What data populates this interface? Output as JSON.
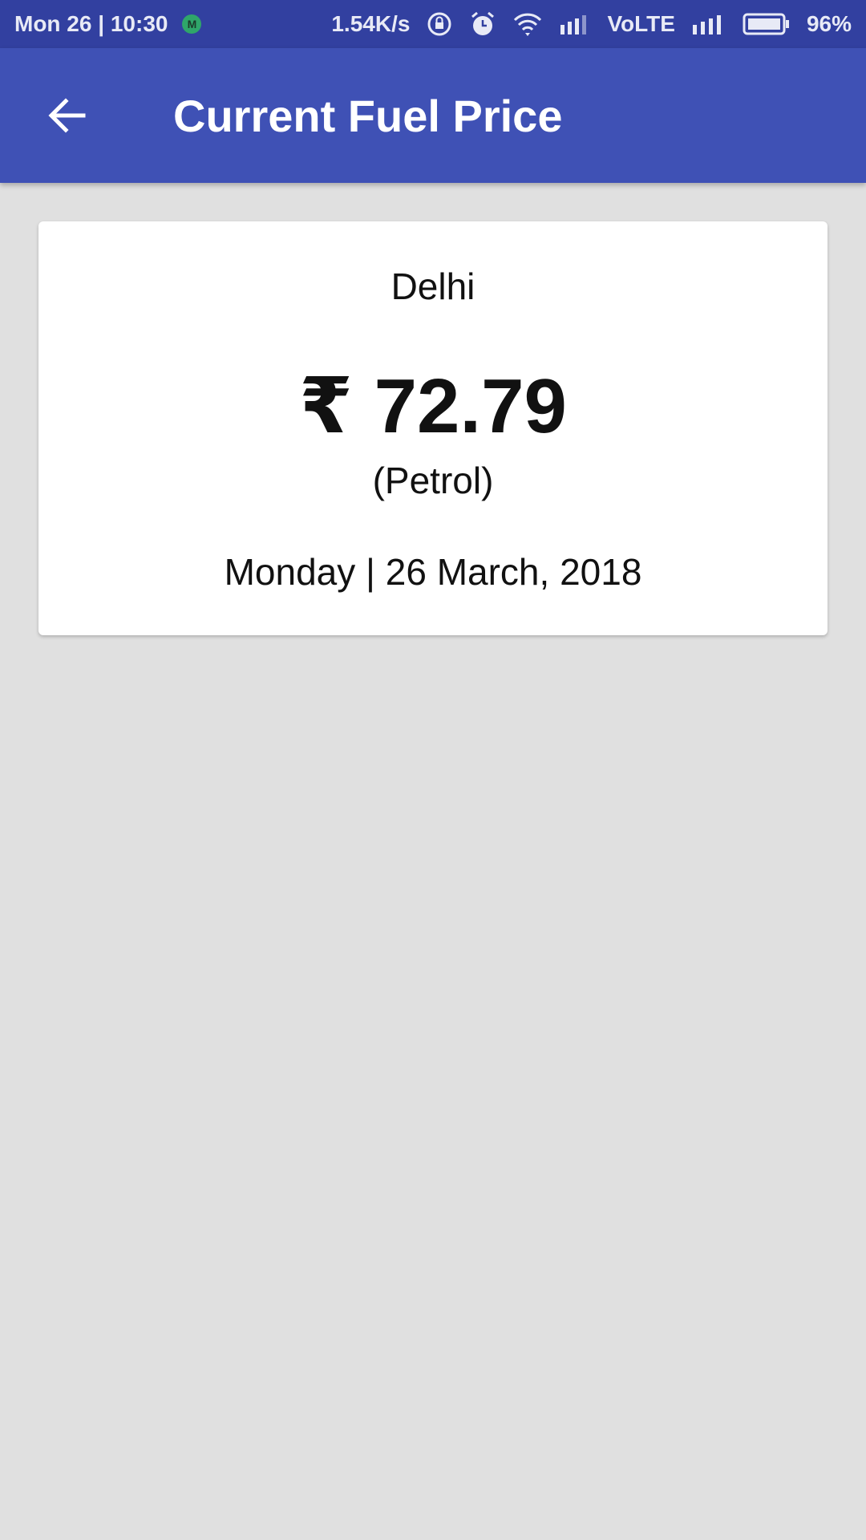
{
  "status_bar": {
    "time": "Mon 26 | 10:30",
    "badge": "M",
    "speed": "1.54K/s",
    "network": "VoLTE",
    "battery": "96%",
    "icons": [
      "rotation-lock-icon",
      "alarm-icon",
      "wifi-icon",
      "signal-icon",
      "signal-icon",
      "battery-icon"
    ]
  },
  "app_bar": {
    "title": "Current Fuel Price",
    "back_icon": "arrow-back-icon"
  },
  "card": {
    "city": "Delhi",
    "price": "₹ 72.79",
    "fuel_type": "(Petrol)",
    "date": "Monday | 26 March, 2018"
  },
  "colors": {
    "status_bar": "#3240a0",
    "app_bar": "#3f51b5",
    "background": "#e0e0e0",
    "card": "#ffffff"
  }
}
